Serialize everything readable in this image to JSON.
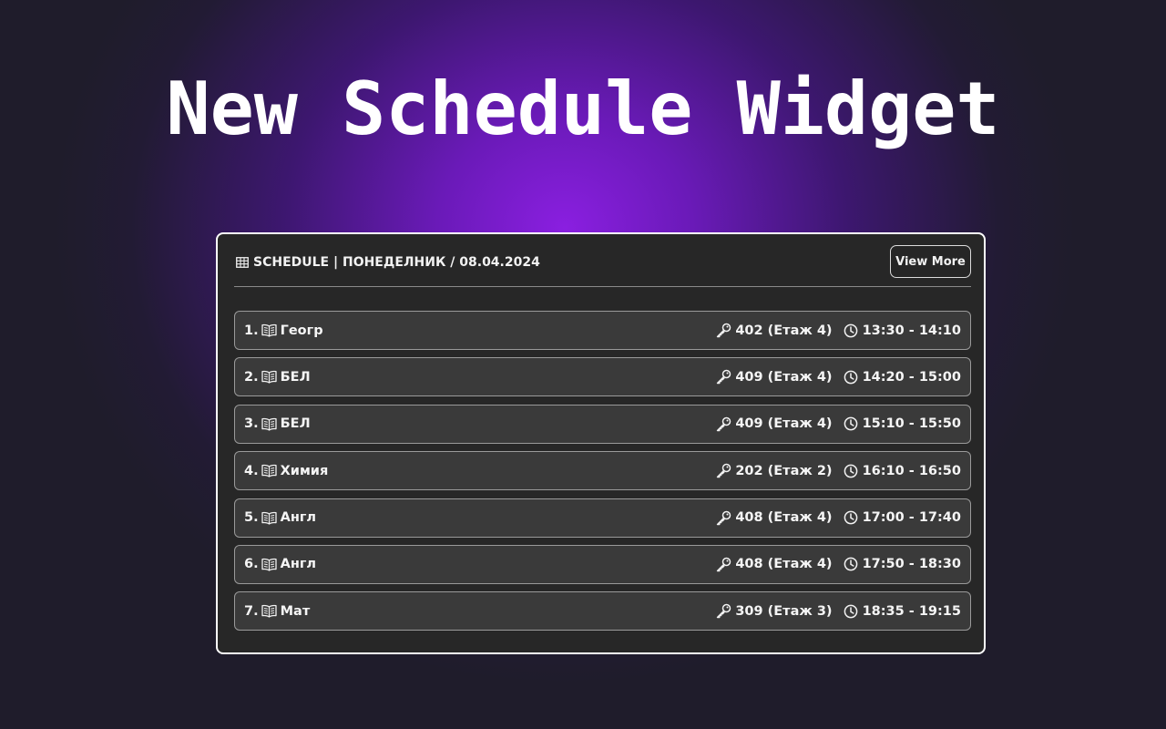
{
  "hero": {
    "title": "New Schedule Widget"
  },
  "widget": {
    "header_icon": "table-icon",
    "title": "SCHEDULE | ПОНЕДЕЛНИК / 08.04.2024",
    "view_more_label": "View More"
  },
  "icons": {
    "subject": "book-icon",
    "room": "key-icon",
    "time": "clock-icon"
  },
  "colors": {
    "panel_bg": "#272727",
    "row_bg": "#3a3a3a",
    "accent_glow": "#8a1fe0"
  },
  "lessons": [
    {
      "num": "1.",
      "subject": "Геогр",
      "room": "402 (Етаж 4)",
      "time": "13:30 - 14:10"
    },
    {
      "num": "2.",
      "subject": "БЕЛ",
      "room": "409 (Етаж 4)",
      "time": "14:20 - 15:00"
    },
    {
      "num": "3.",
      "subject": "БЕЛ",
      "room": "409 (Етаж 4)",
      "time": "15:10 - 15:50"
    },
    {
      "num": "4.",
      "subject": "Химия",
      "room": "202 (Етаж 2)",
      "time": "16:10 - 16:50"
    },
    {
      "num": "5.",
      "subject": "Англ",
      "room": "408 (Етаж 4)",
      "time": "17:00 - 17:40"
    },
    {
      "num": "6.",
      "subject": "Англ",
      "room": "408 (Етаж 4)",
      "time": "17:50 - 18:30"
    },
    {
      "num": "7.",
      "subject": "Мат",
      "room": "309 (Етаж 3)",
      "time": "18:35 - 19:15"
    }
  ]
}
